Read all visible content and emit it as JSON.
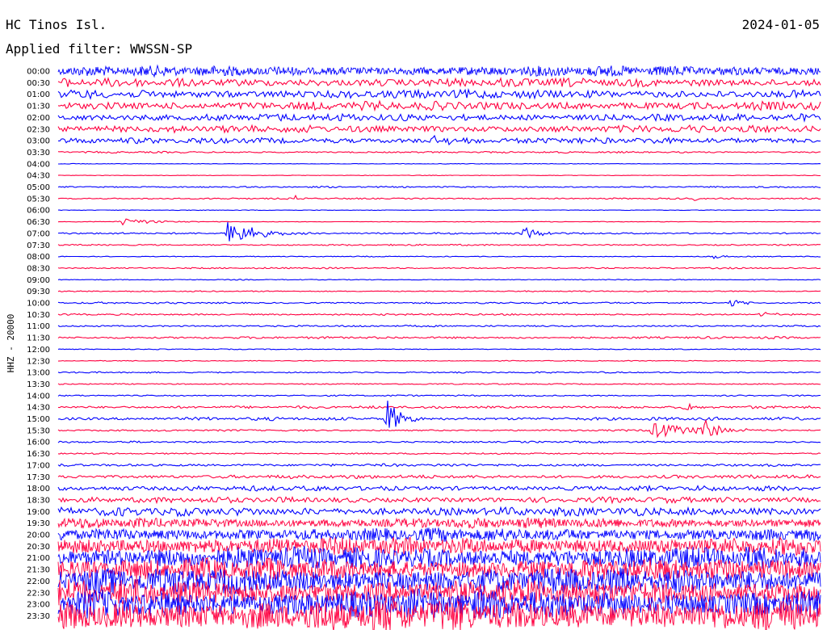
{
  "header": {
    "station": "HC Tinos Isl.",
    "date": "2024-01-05",
    "filter": "Applied filter: WWSSN-SP"
  },
  "chart_data": {
    "type": "line",
    "title": "HC Tinos Isl.",
    "channel_label": "HHZ - 20000",
    "row_labels": [
      "00:00",
      "00:30",
      "01:00",
      "01:30",
      "02:00",
      "02:30",
      "03:00",
      "03:30",
      "04:00",
      "04:30",
      "05:00",
      "05:30",
      "06:00",
      "06:30",
      "07:00",
      "07:30",
      "08:00",
      "08:30",
      "09:00",
      "09:30",
      "10:00",
      "10:30",
      "11:00",
      "11:30",
      "12:00",
      "12:30",
      "13:00",
      "13:30",
      "14:00",
      "14:30",
      "15:00",
      "15:30",
      "16:00",
      "16:30",
      "17:00",
      "17:30",
      "18:00",
      "18:30",
      "19:00",
      "19:30",
      "20:00",
      "20:30",
      "21:00",
      "21:30",
      "22:00",
      "22:30",
      "23:00",
      "23:30"
    ],
    "colors": [
      "#0000ff",
      "#ff0040"
    ],
    "noise_level": [
      7,
      6,
      6,
      6,
      5,
      5,
      4,
      1.2,
      0.4,
      0.4,
      1,
      1,
      0.4,
      0.4,
      1.2,
      1,
      0.6,
      1,
      0.6,
      0.8,
      1.2,
      1.2,
      1.2,
      1.5,
      0.6,
      0.6,
      1,
      0.8,
      1,
      1.8,
      2.2,
      1.2,
      1.2,
      1,
      1.8,
      2.5,
      3.5,
      4,
      6,
      7,
      9,
      12,
      15,
      15,
      18,
      18,
      20,
      22
    ],
    "events": [
      {
        "row": 6,
        "t": 0.49,
        "amp": 5,
        "width": 0.04
      },
      {
        "row": 11,
        "t": 0.31,
        "amp": 8,
        "width": 0.004
      },
      {
        "row": 11,
        "t": 0.83,
        "amp": 4,
        "width": 0.01
      },
      {
        "row": 13,
        "t": 0.08,
        "amp": 5,
        "width": 0.04
      },
      {
        "row": 14,
        "t": 0.22,
        "amp": 22,
        "width": 0.03
      },
      {
        "row": 14,
        "t": 0.61,
        "amp": 9,
        "width": 0.02
      },
      {
        "row": 16,
        "t": 0.86,
        "amp": 4,
        "width": 0.01
      },
      {
        "row": 20,
        "t": 0.88,
        "amp": 6,
        "width": 0.015
      },
      {
        "row": 21,
        "t": 0.92,
        "amp": 4,
        "width": 0.015
      },
      {
        "row": 30,
        "t": 0.43,
        "amp": 28,
        "width": 0.015
      },
      {
        "row": 29,
        "t": 0.82,
        "amp": 8,
        "width": 0.01
      },
      {
        "row": 31,
        "t": 0.78,
        "amp": 10,
        "width": 0.06
      },
      {
        "row": 31,
        "t": 0.845,
        "amp": 24,
        "width": 0.012
      }
    ]
  }
}
